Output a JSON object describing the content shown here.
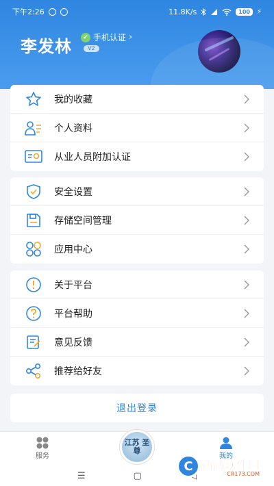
{
  "status_bar": {
    "time": "下午2:26",
    "network_speed": "11.8K/s",
    "battery": "100"
  },
  "profile": {
    "name": "李发林",
    "verify_label": "手机认证",
    "level": "V2"
  },
  "menu_group_1": [
    {
      "label": "我的收藏",
      "icon": "star-icon"
    },
    {
      "label": "个人资料",
      "icon": "profile-card-icon"
    },
    {
      "label": "从业人员附加认证",
      "icon": "certificate-icon"
    }
  ],
  "menu_group_2": [
    {
      "label": "安全设置",
      "icon": "shield-icon"
    },
    {
      "label": "存储空间管理",
      "icon": "save-disk-icon"
    },
    {
      "label": "应用中心",
      "icon": "apps-grid-icon"
    }
  ],
  "menu_group_3": [
    {
      "label": "关于平台",
      "icon": "info-icon"
    },
    {
      "label": "平台帮助",
      "icon": "help-icon"
    },
    {
      "label": "意见反馈",
      "icon": "feedback-icon"
    },
    {
      "label": "推荐给好友",
      "icon": "share-icon"
    }
  ],
  "logout_label": "退出登录",
  "bottom_nav": {
    "service_label": "服务",
    "center_label": "江苏 圣尊",
    "mine_label": "我的"
  },
  "watermark": {
    "main": "西西软件园",
    "sub": "CR173.COM"
  },
  "colors": {
    "accent": "#2f86e0",
    "icon_stroke": "#2f86e0"
  }
}
